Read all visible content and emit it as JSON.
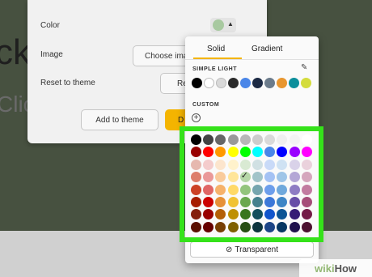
{
  "background": {
    "title_fragment": "ck",
    "subtitle_fragment": "Clic"
  },
  "panel": {
    "color_label": "Color",
    "image_label": "Image",
    "choose_image_label": "Choose ima",
    "reset_label": "Reset to theme",
    "reset_button_label": "Re",
    "add_to_theme_label": "Add to theme",
    "done_fragment": "D",
    "current_color": "#a8c9a0"
  },
  "picker": {
    "tabs": [
      {
        "label": "Solid",
        "active": true
      },
      {
        "label": "Gradient",
        "active": false
      }
    ],
    "theme_section_label": "SIMPLE LIGHT",
    "edit_icon": "pencil-icon",
    "theme_colors": [
      "#000000",
      "#ffffff",
      "#d9d9d9",
      "#2a2a2a",
      "#4a86e8",
      "#1c2a44",
      "#6b7b8b",
      "#e8962f",
      "#0c8e9b",
      "#d4dc3c"
    ],
    "custom_section_label": "CUSTOM",
    "add_custom_icon": "plus-circle-icon",
    "transparent_label": "Transparent",
    "transparent_icon": "no-fill-icon",
    "selected_color": "#b6d7a8",
    "palette": [
      [
        "#000000",
        "#434343",
        "#666666",
        "#999999",
        "#b7b7b7",
        "#cccccc",
        "#d9d9d9",
        "#efefef",
        "#f3f3f3",
        "#ffffff"
      ],
      [
        "#980000",
        "#ff0000",
        "#ff9900",
        "#ffff00",
        "#00ff00",
        "#00ffff",
        "#4a86e8",
        "#0000ff",
        "#9900ff",
        "#ff00ff"
      ],
      [
        "#e6b8af",
        "#f4cccc",
        "#fce5cd",
        "#fff2cc",
        "#d9ead3",
        "#d0e0e3",
        "#c9daf8",
        "#cfe2f3",
        "#d9d2e9",
        "#ead1dc"
      ],
      [
        "#dd7e6b",
        "#ea9999",
        "#f9cb9c",
        "#ffe599",
        "#b6d7a8",
        "#a2c4c9",
        "#a4c2f4",
        "#9fc5e8",
        "#b4a7d6",
        "#d5a6bd"
      ],
      [
        "#cc4125",
        "#e06666",
        "#f6b26b",
        "#ffd966",
        "#93c47d",
        "#76a5af",
        "#6d9eeb",
        "#6fa8dc",
        "#8e7cc3",
        "#c27ba0"
      ],
      [
        "#a61c00",
        "#cc0000",
        "#e69138",
        "#f1c232",
        "#6aa84f",
        "#45818e",
        "#3c78d8",
        "#3d85c6",
        "#674ea7",
        "#a64d79"
      ],
      [
        "#85200c",
        "#990000",
        "#b45f06",
        "#bf9000",
        "#38761d",
        "#134f5c",
        "#1155cc",
        "#0b5394",
        "#351c75",
        "#741b47"
      ],
      [
        "#5b0f00",
        "#660000",
        "#783f04",
        "#7f6000",
        "#274e13",
        "#0c343d",
        "#1c4587",
        "#073763",
        "#20124d",
        "#4c1130"
      ]
    ]
  },
  "watermark": {
    "part1": "wiki",
    "part2": "How"
  }
}
